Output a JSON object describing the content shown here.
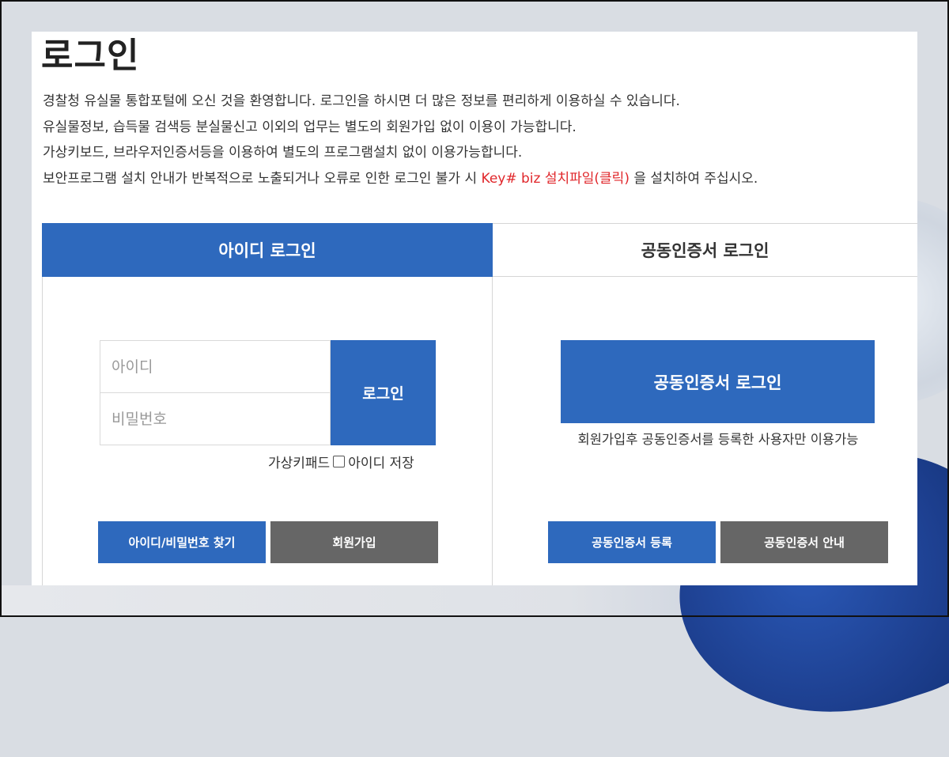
{
  "page": {
    "title": "로그인",
    "intro": [
      "경찰청 유실물 통합포털에 오신 것을 환영합니다. 로그인을 하시면 더 많은 정보를 편리하게 이용하실 수 있습니다.",
      "유실물정보, 습득물 검색등 분실물신고 이외의 업무는 별도의 회원가입 없이 이용이 가능합니다.",
      "가상키보드, 브라우저인증서등을 이용하여 별도의 프로그램설치 없이 이용가능합니다."
    ],
    "notice": {
      "before": "보안프로그램 설치 안내가 반복적으로 노출되거나 오류로 인한 로그인 불가 시 ",
      "link": "Key# biz 설치파일(클릭)",
      "after": " 을 설치하여 주십시오."
    }
  },
  "tabs": {
    "id_login": "아이디 로그인",
    "cert_login": "공동인증서 로그인"
  },
  "id_login": {
    "id_placeholder": "아이디",
    "pw_placeholder": "비밀번호",
    "login_button": "로그인",
    "virtual_keypad": "가상키패드",
    "save_id": "아이디 저장",
    "find_button": "아이디/비밀번호 찾기",
    "signup_button": "회원가입"
  },
  "cert_login": {
    "login_button": "공동인증서 로그인",
    "note": "회원가입후 공동인증서를 등록한 사용자만 이용가능",
    "register_button": "공동인증서 등록",
    "guide_button": "공동인증서 안내"
  },
  "colors": {
    "primary": "#2e69bd",
    "secondary": "#666666",
    "link_red": "#e0262a"
  }
}
